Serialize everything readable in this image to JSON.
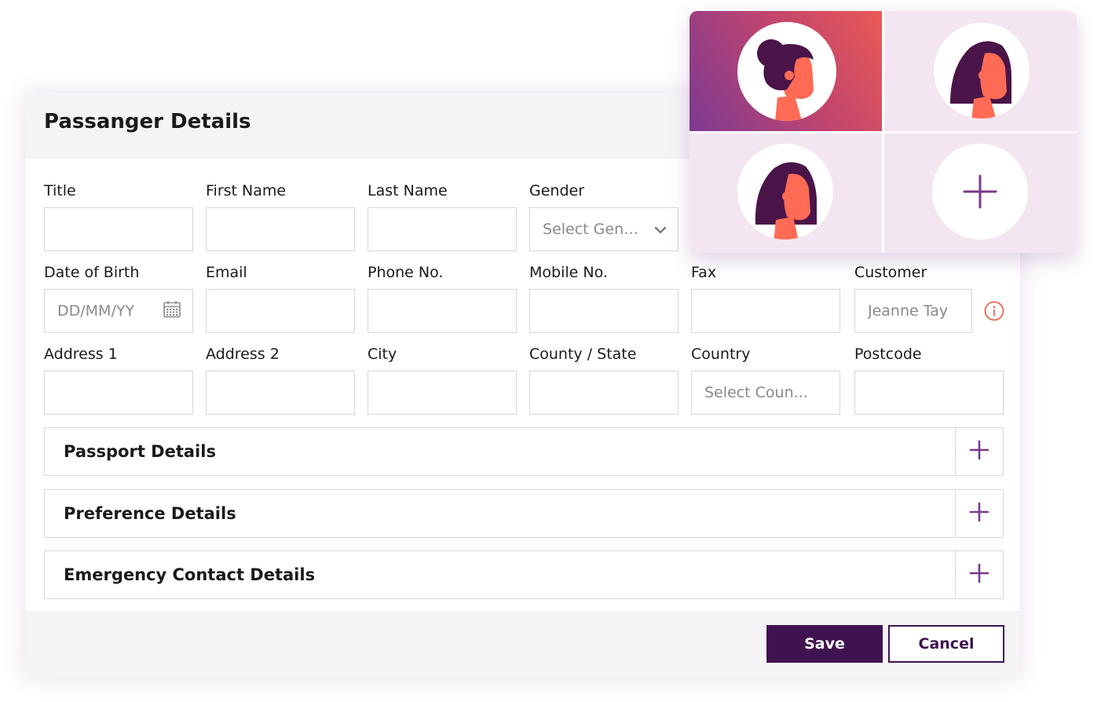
{
  "form": {
    "title": "Passanger Details",
    "fields": {
      "title": {
        "label": "Title",
        "value": ""
      },
      "first_name": {
        "label": "First Name",
        "value": ""
      },
      "last_name": {
        "label": "Last Name",
        "value": ""
      },
      "gender": {
        "label": "Gender",
        "placeholder": "Select Gend..."
      },
      "dob": {
        "label": "Date of Birth",
        "placeholder": "DD/MM/YY"
      },
      "email": {
        "label": "Email",
        "value": ""
      },
      "phone": {
        "label": "Phone No.",
        "value": ""
      },
      "mobile": {
        "label": "Mobile No.",
        "value": ""
      },
      "fax": {
        "label": "Fax",
        "value": ""
      },
      "customer": {
        "label": "Customer",
        "value": "Jeanne Tay"
      },
      "address1": {
        "label": "Address 1",
        "value": ""
      },
      "address2": {
        "label": "Address 2",
        "value": ""
      },
      "city": {
        "label": "City",
        "value": ""
      },
      "county_state": {
        "label": "County / State",
        "value": ""
      },
      "country": {
        "label": "Country",
        "placeholder": "Select Coun..."
      },
      "postcode": {
        "label": "Postcode",
        "value": ""
      }
    },
    "sections": [
      {
        "title": "Passport Details"
      },
      {
        "title": "Preference Details"
      },
      {
        "title": "Emergency Contact Details"
      }
    ],
    "buttons": {
      "save": "Save",
      "cancel": "Cancel"
    }
  },
  "avatar_picker": {
    "tiles": [
      {
        "icon": "woman-bun-avatar",
        "selected": true
      },
      {
        "icon": "woman-long-hair-avatar",
        "selected": false
      },
      {
        "icon": "woman-long-hair-avatar",
        "selected": false
      },
      {
        "icon": "plus-icon",
        "selected": false
      }
    ]
  },
  "colors": {
    "brand_purple": "#3f1350",
    "accent_purple": "#7a3a8c",
    "avatar_skin": "#ff6b55",
    "avatar_hair": "#4a1449",
    "info_red": "#e8674f",
    "tile_bg": "#f3e6f0"
  }
}
